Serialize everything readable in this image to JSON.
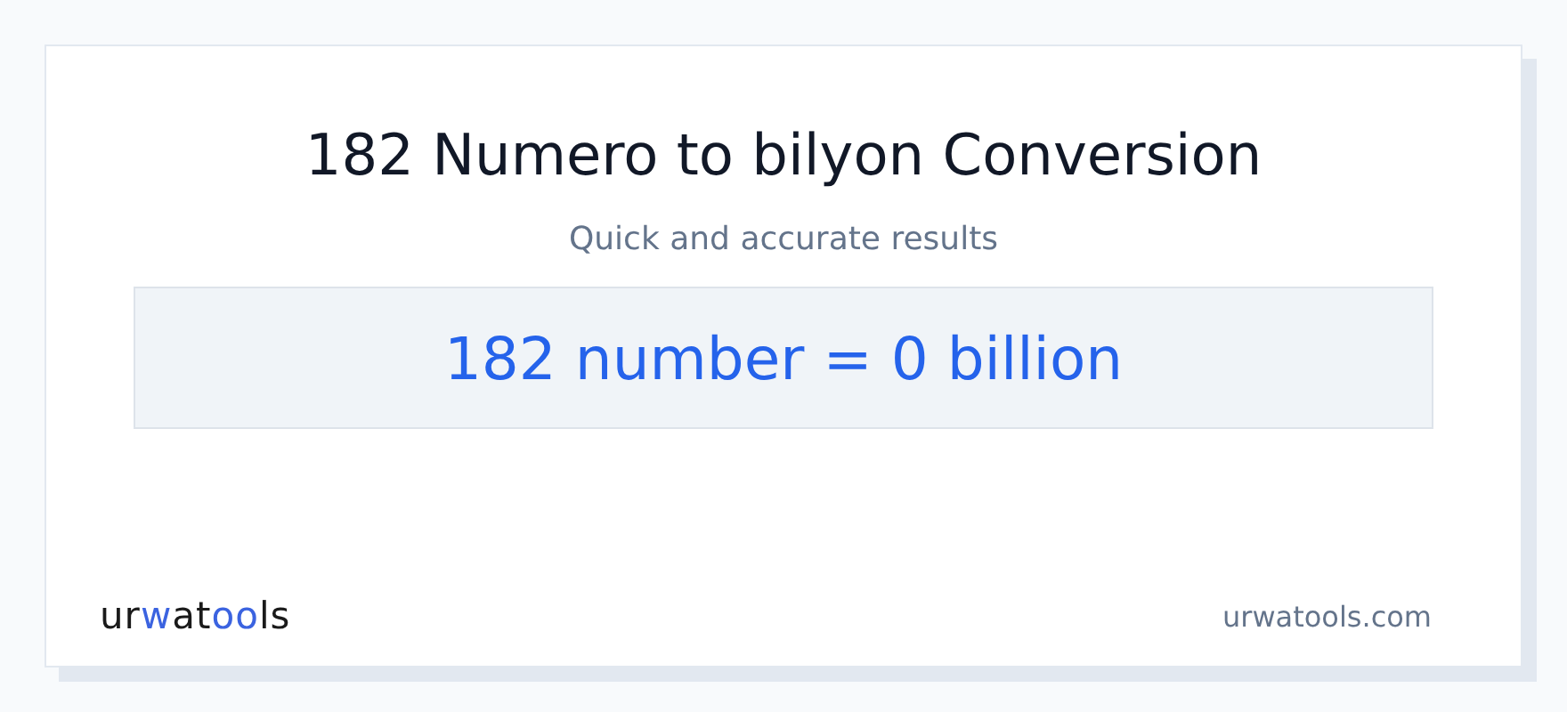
{
  "title": "182 Numero to bilyon Conversion",
  "subtitle": "Quick and accurate results",
  "result": "182 number = 0 billion",
  "logo": {
    "parts": [
      {
        "text": "ur",
        "color": "#1a1a1a"
      },
      {
        "text": "w",
        "color": "#3b63e0"
      },
      {
        "text": "at",
        "color": "#1a1a1a"
      },
      {
        "text": "oo",
        "color": "#3b63e0"
      },
      {
        "text": "ls",
        "color": "#1a1a1a"
      }
    ]
  },
  "site": "urwatools.com"
}
